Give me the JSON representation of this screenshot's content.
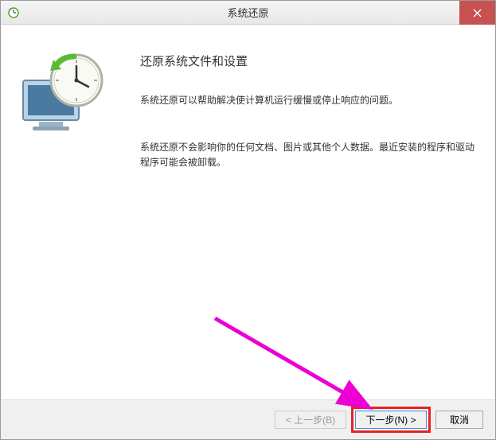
{
  "titlebar": {
    "title": "系统还原",
    "close_label": "×"
  },
  "content": {
    "heading": "还原系统文件和设置",
    "paragraph1": "系统还原可以帮助解决使计算机运行缓慢或停止响应的问题。",
    "paragraph2": "系统还原不会影响你的任何文档、图片或其他个人数据。最近安装的程序和驱动程序可能会被卸载。"
  },
  "footer": {
    "back_label": "< 上一步(B)",
    "next_label": "下一步(N) >",
    "cancel_label": "取消"
  },
  "annotation": {
    "arrow_color": "#ec00d5"
  }
}
